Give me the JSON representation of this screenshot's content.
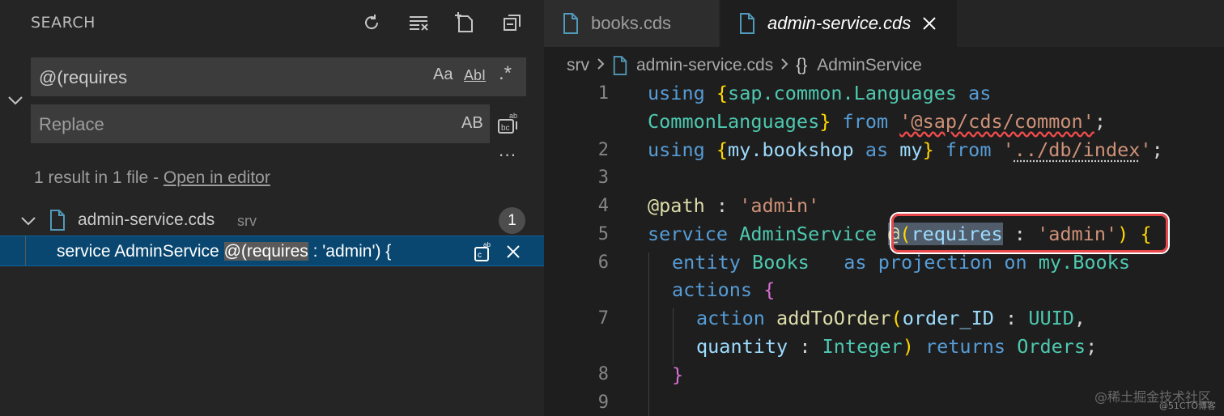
{
  "sidebar": {
    "title": "SEARCH",
    "actions": [
      {
        "name": "refresh-icon"
      },
      {
        "name": "clear-results-icon"
      },
      {
        "name": "new-search-editor-icon"
      },
      {
        "name": "collapse-all-icon"
      }
    ],
    "search": {
      "value": "@(requires",
      "options": [
        "Aa",
        "AbI",
        ".*"
      ]
    },
    "replace": {
      "placeholder": "Replace",
      "preserve_case": "AB"
    },
    "more": "···",
    "summary_text": "1 result in 1 file - ",
    "summary_link": "Open in editor",
    "file": {
      "name": "admin-service.cds",
      "path": "srv",
      "count": "1"
    },
    "match": {
      "before": "service AdminService ",
      "highlight": "@(requires",
      "after": " : 'admin') {"
    }
  },
  "editor": {
    "tabs": [
      {
        "label": "books.cds",
        "active": false
      },
      {
        "label": "admin-service.cds",
        "active": true
      }
    ],
    "breadcrumb": {
      "folder": "srv",
      "file": "admin-service.cds",
      "symbol_glyph": "{}",
      "symbol": "AdminService"
    },
    "line_numbers": [
      "1",
      "2",
      "3",
      "4",
      "5",
      "6",
      "7",
      "8",
      "9"
    ],
    "code": {
      "l1a": {
        "t1": "using ",
        "t2": "{",
        "t3": "sap.common.Languages",
        "t4": " as"
      },
      "l1b": {
        "t1": "CommonLanguages",
        "t2": "}",
        "t3": " from ",
        "t4": "'@sap/cds/common'",
        "t5": ";"
      },
      "l2": {
        "t1": "using ",
        "t2": "{",
        "t3": "my.bookshop",
        "t4": " as ",
        "t5": "my",
        "t6": "}",
        "t7": " from ",
        "t8": "'",
        "t9": "../db/index",
        "t10": "'",
        "t11": ";"
      },
      "l4": {
        "t1": "@path",
        "t2": " : ",
        "t3": "'admin'"
      },
      "l5": {
        "t1": "service ",
        "t2": "AdminService ",
        "t3": "@",
        "t4": "(",
        "t5": "requires",
        "t6": " : ",
        "t7": "'admin'",
        "t8": ")",
        "t9": " ",
        "t10": "{"
      },
      "l6a": {
        "t1": "entity ",
        "t2": "Books",
        "t3": "   as ",
        "t4": "projection ",
        "t5": "on ",
        "t6": "my.Books"
      },
      "l6b": {
        "t1": "actions ",
        "t2": "{"
      },
      "l7a": {
        "t1": "action ",
        "t2": "addToOrder",
        "t3": "(",
        "t4": "order_ID",
        "t5": " : ",
        "t6": "UUID",
        "t7": ","
      },
      "l7b": {
        "t1": "quantity",
        "t2": " : ",
        "t3": "Integer",
        "t4": ")",
        "t5": " returns ",
        "t6": "Orders",
        "t7": ";"
      },
      "l8": {
        "t1": "}"
      }
    }
  },
  "watermark": "@稀土掘金技术社区",
  "watermark2": "@51CTO博客",
  "colors": {
    "keyword": "#569cd6",
    "identifier": "#9cdcfe",
    "type": "#4ec9b0",
    "string": "#ce9178",
    "function": "#dcdcaa",
    "selection": "#094771",
    "annotation_box": "#e8474c"
  }
}
